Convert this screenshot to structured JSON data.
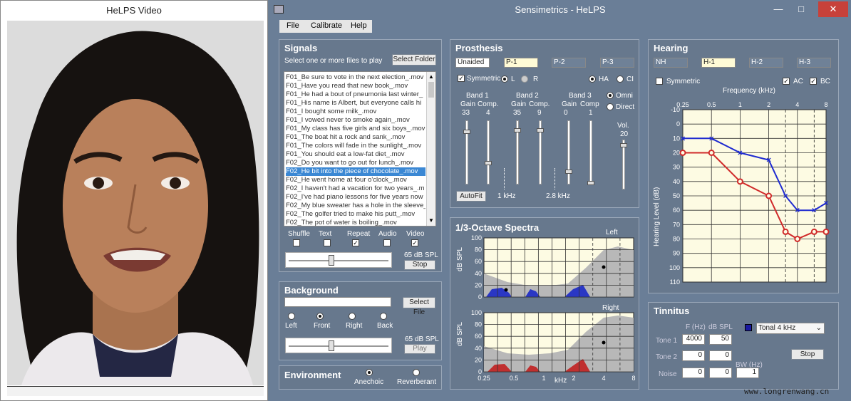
{
  "video_window": {
    "title": "HeLPS Video"
  },
  "main_window": {
    "title": "Sensimetrics - HeLPS",
    "colors": {
      "close": "#c7413a",
      "bg": "#6a7e97"
    }
  },
  "menu": {
    "items": [
      "File",
      "Calibrate",
      "Help"
    ]
  },
  "signals": {
    "title": "Signals",
    "subtitle": "Select one or more files to play",
    "select_folder": "Select Folder",
    "files": [
      "F01_Be sure to vote in the next election_.mov",
      "F01_Have you read that new book_.mov",
      "F01_He had a bout of pneumonia last winter_",
      "F01_His name is Albert, but everyone calls hi",
      "F01_I bought some milk_.mov",
      "F01_I vowed never to smoke again_.mov",
      "F01_My class has five girls and six boys_.mov",
      "F01_The boat hit a rock and sank_.mov",
      "F01_The colors will fade in the sunlight_.mov",
      "F01_You should eat a low-fat diet_.mov",
      "F02_Do you want to go out for lunch_.mov",
      "F02_He bit into the piece of chocolate_.mov",
      "F02_He went home at four o'clock_.mov",
      "F02_I haven't had a vacation for two years_.m",
      "F02_I've had piano lessons for five years now",
      "F02_My blue sweater has a hole in the sleeve_",
      "F02_The golfer tried to make his putt_.mov",
      "F02_The pot of water is boiling_.mov"
    ],
    "selected_index": 11,
    "options": [
      {
        "label": "Shuffle",
        "checked": false
      },
      {
        "label": "Text",
        "checked": false
      },
      {
        "label": "Repeat",
        "checked": true
      },
      {
        "label": "Audio",
        "checked": false
      },
      {
        "label": "Video",
        "checked": true
      }
    ],
    "level": "65 dB SPL",
    "stop": "Stop"
  },
  "background": {
    "title": "Background",
    "select_file": "Select File",
    "positions": [
      "Left",
      "Front",
      "Right",
      "Back"
    ],
    "selected_position": "Front",
    "level": "65 dB SPL",
    "play": "Play"
  },
  "environment": {
    "title": "Environment",
    "options": [
      "Anechoic",
      "Reverberant"
    ],
    "selected": "Anechoic"
  },
  "prosthesis": {
    "title": "Prosthesis",
    "presets": [
      "Unaided",
      "P-1",
      "P-2",
      "P-3"
    ],
    "selected_preset": "P-1",
    "symmetric_label": "Symmetric",
    "symmetric": true,
    "ear_L": "L",
    "ear_R": "R",
    "type_HA": "HA",
    "type_CI": "CI",
    "bands": [
      {
        "name": "Band 1",
        "gain": 33,
        "comp": 4
      },
      {
        "name": "Band 2",
        "gain": 35,
        "comp": 9
      },
      {
        "name": "Band 3",
        "gain": 0,
        "comp": 1
      }
    ],
    "gain_label": "Gain",
    "comp_label": "Comp.",
    "comp_label_short": "Comp",
    "mic_omni": "Omni",
    "mic_direct": "Direct",
    "vol_label": "Vol.",
    "vol": 20,
    "autofit": "AutoFit",
    "crossover_1": "1 kHz",
    "crossover_2": "2.8 kHz"
  },
  "spectra": {
    "title": "1/3-Octave Spectra",
    "left_label": "Left",
    "right_label": "Right",
    "ylabel": "dB SPL",
    "xlabel": "kHz",
    "y_ticks": [
      "100",
      "80",
      "60",
      "40",
      "20",
      "0"
    ],
    "x_ticks": [
      "0.25",
      "0.5",
      "1",
      "2",
      "4",
      "8"
    ],
    "colors": {
      "target": "#2a37c4",
      "background": "#c02f2f",
      "plot": "#fdfbe3",
      "noise": "#b8b8b8"
    }
  },
  "hearing": {
    "title": "Hearing",
    "presets": [
      "NH",
      "H-1",
      "H-2",
      "H-3"
    ],
    "selected_preset": "H-1",
    "symmetric_label": "Symmetric",
    "symmetric": false,
    "ac_label": "AC",
    "ac": true,
    "bc_label": "BC",
    "bc": true,
    "xlabel": "Frequency (kHz)",
    "ylabel": "Hearing Level (dB)",
    "x_ticks": [
      "0.25",
      "0.5",
      "1",
      "2",
      "4",
      "8"
    ],
    "y_ticks": [
      "-10",
      "0",
      "10",
      "20",
      "30",
      "40",
      "50",
      "60",
      "70",
      "80",
      "90",
      "100",
      "110"
    ]
  },
  "chart_data": [
    {
      "type": "line",
      "title": "",
      "xlabel": "Frequency (kHz)",
      "ylabel": "Hearing Level (dB)",
      "x": [
        0.25,
        0.5,
        1,
        2,
        3,
        4,
        6,
        8
      ],
      "ylim": [
        -10,
        110
      ],
      "y_inverted": true,
      "grid": true,
      "series": [
        {
          "color": "#1f2bd0",
          "values": [
            10,
            10,
            20,
            25,
            50,
            60,
            60,
            55
          ]
        },
        {
          "color": "#d02a2a",
          "values": [
            20,
            20,
            40,
            50,
            75,
            80,
            75,
            75
          ]
        }
      ]
    }
  ],
  "tinnitus": {
    "title": "Tinnitus",
    "f_label": "F (Hz)",
    "db_label": "dB SPL",
    "bw_label": "BW (Hz)",
    "rows": [
      {
        "label": "Tone 1",
        "f": "4000",
        "db": "50"
      },
      {
        "label": "Tone 2",
        "f": "0",
        "db": "0"
      },
      {
        "label": "Noise",
        "f": "0",
        "db": "0",
        "bw": "1"
      }
    ],
    "type": "Tonal 4 kHz",
    "type_color": "#1a1aa0",
    "stop": "Stop"
  },
  "watermark": "www.longrenwang.cn"
}
